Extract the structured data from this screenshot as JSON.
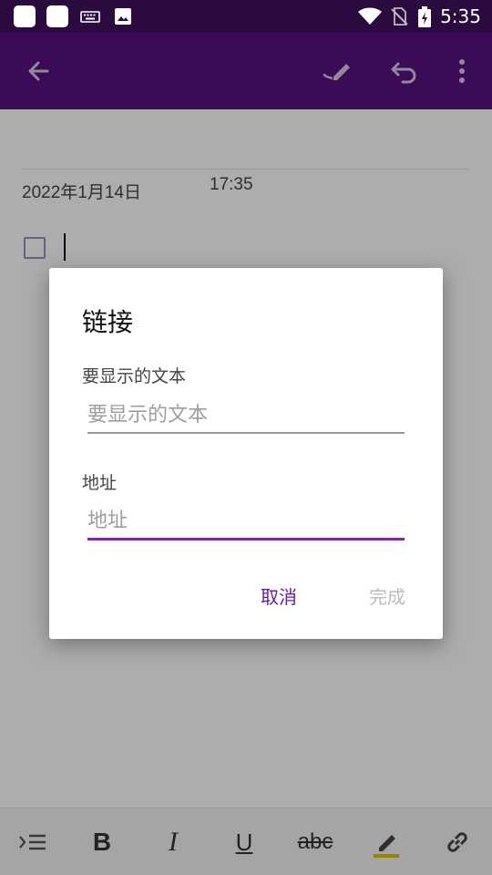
{
  "status_bar": {
    "time": "5:35",
    "icons": [
      "app-icon",
      "app-icon",
      "keyboard-icon",
      "image-icon",
      "wifi-icon",
      "no-sim-icon",
      "battery-icon"
    ]
  },
  "toolbar": {
    "icons": [
      "back-arrow-icon",
      "ink-pen-icon",
      "undo-icon",
      "more-vert-icon"
    ]
  },
  "note": {
    "date": "2022年1月14日",
    "time": "17:35"
  },
  "dialog": {
    "title": "链接",
    "display_text_label": "要显示的文本",
    "display_text_placeholder": "要显示的文本",
    "display_text_value": "",
    "address_label": "地址",
    "address_placeholder": "地址",
    "address_value": "",
    "cancel_label": "取消",
    "done_label": "完成"
  },
  "format_bar": {
    "bold": "B",
    "italic": "I",
    "underline": "U",
    "strikethrough": "abc",
    "icons": [
      "indent-list-icon",
      "highlighter-icon",
      "link-icon"
    ]
  },
  "colors": {
    "toolbar": "#571180",
    "status_bar": "#2a0a3f",
    "accent": "#6a1b9a",
    "highlight": "#e0c000"
  }
}
